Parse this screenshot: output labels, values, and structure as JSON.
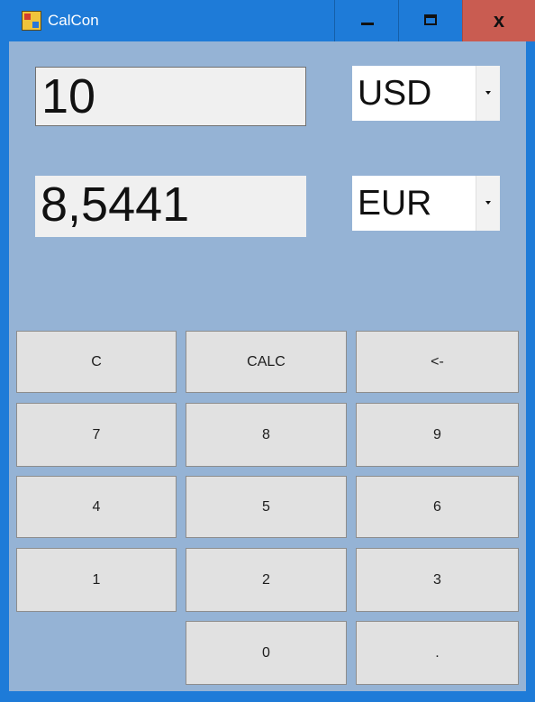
{
  "window": {
    "title": "CalCon",
    "close_label": "x"
  },
  "converter": {
    "source_value": "10",
    "target_value": "8,5441",
    "source_currency": "USD",
    "target_currency": "EUR"
  },
  "keypad": {
    "clear": "C",
    "calc": "CALC",
    "backspace": "<-",
    "seven": "7",
    "eight": "8",
    "nine": "9",
    "four": "4",
    "five": "5",
    "six": "6",
    "one": "1",
    "two": "2",
    "three": "3",
    "zero": "0",
    "decimal": "."
  },
  "icons": {
    "app": "calcon-app-icon",
    "minimize": "minimize-icon",
    "maximize": "maximize-icon",
    "close": "close-icon",
    "dropdown": "chevron-down-icon"
  },
  "colors": {
    "titlebar": "#1e7bd8",
    "client_background": "#95b3d5",
    "close_button": "#c95c51",
    "input_background": "#f0f0f0",
    "key_background": "#e1e1e1"
  }
}
